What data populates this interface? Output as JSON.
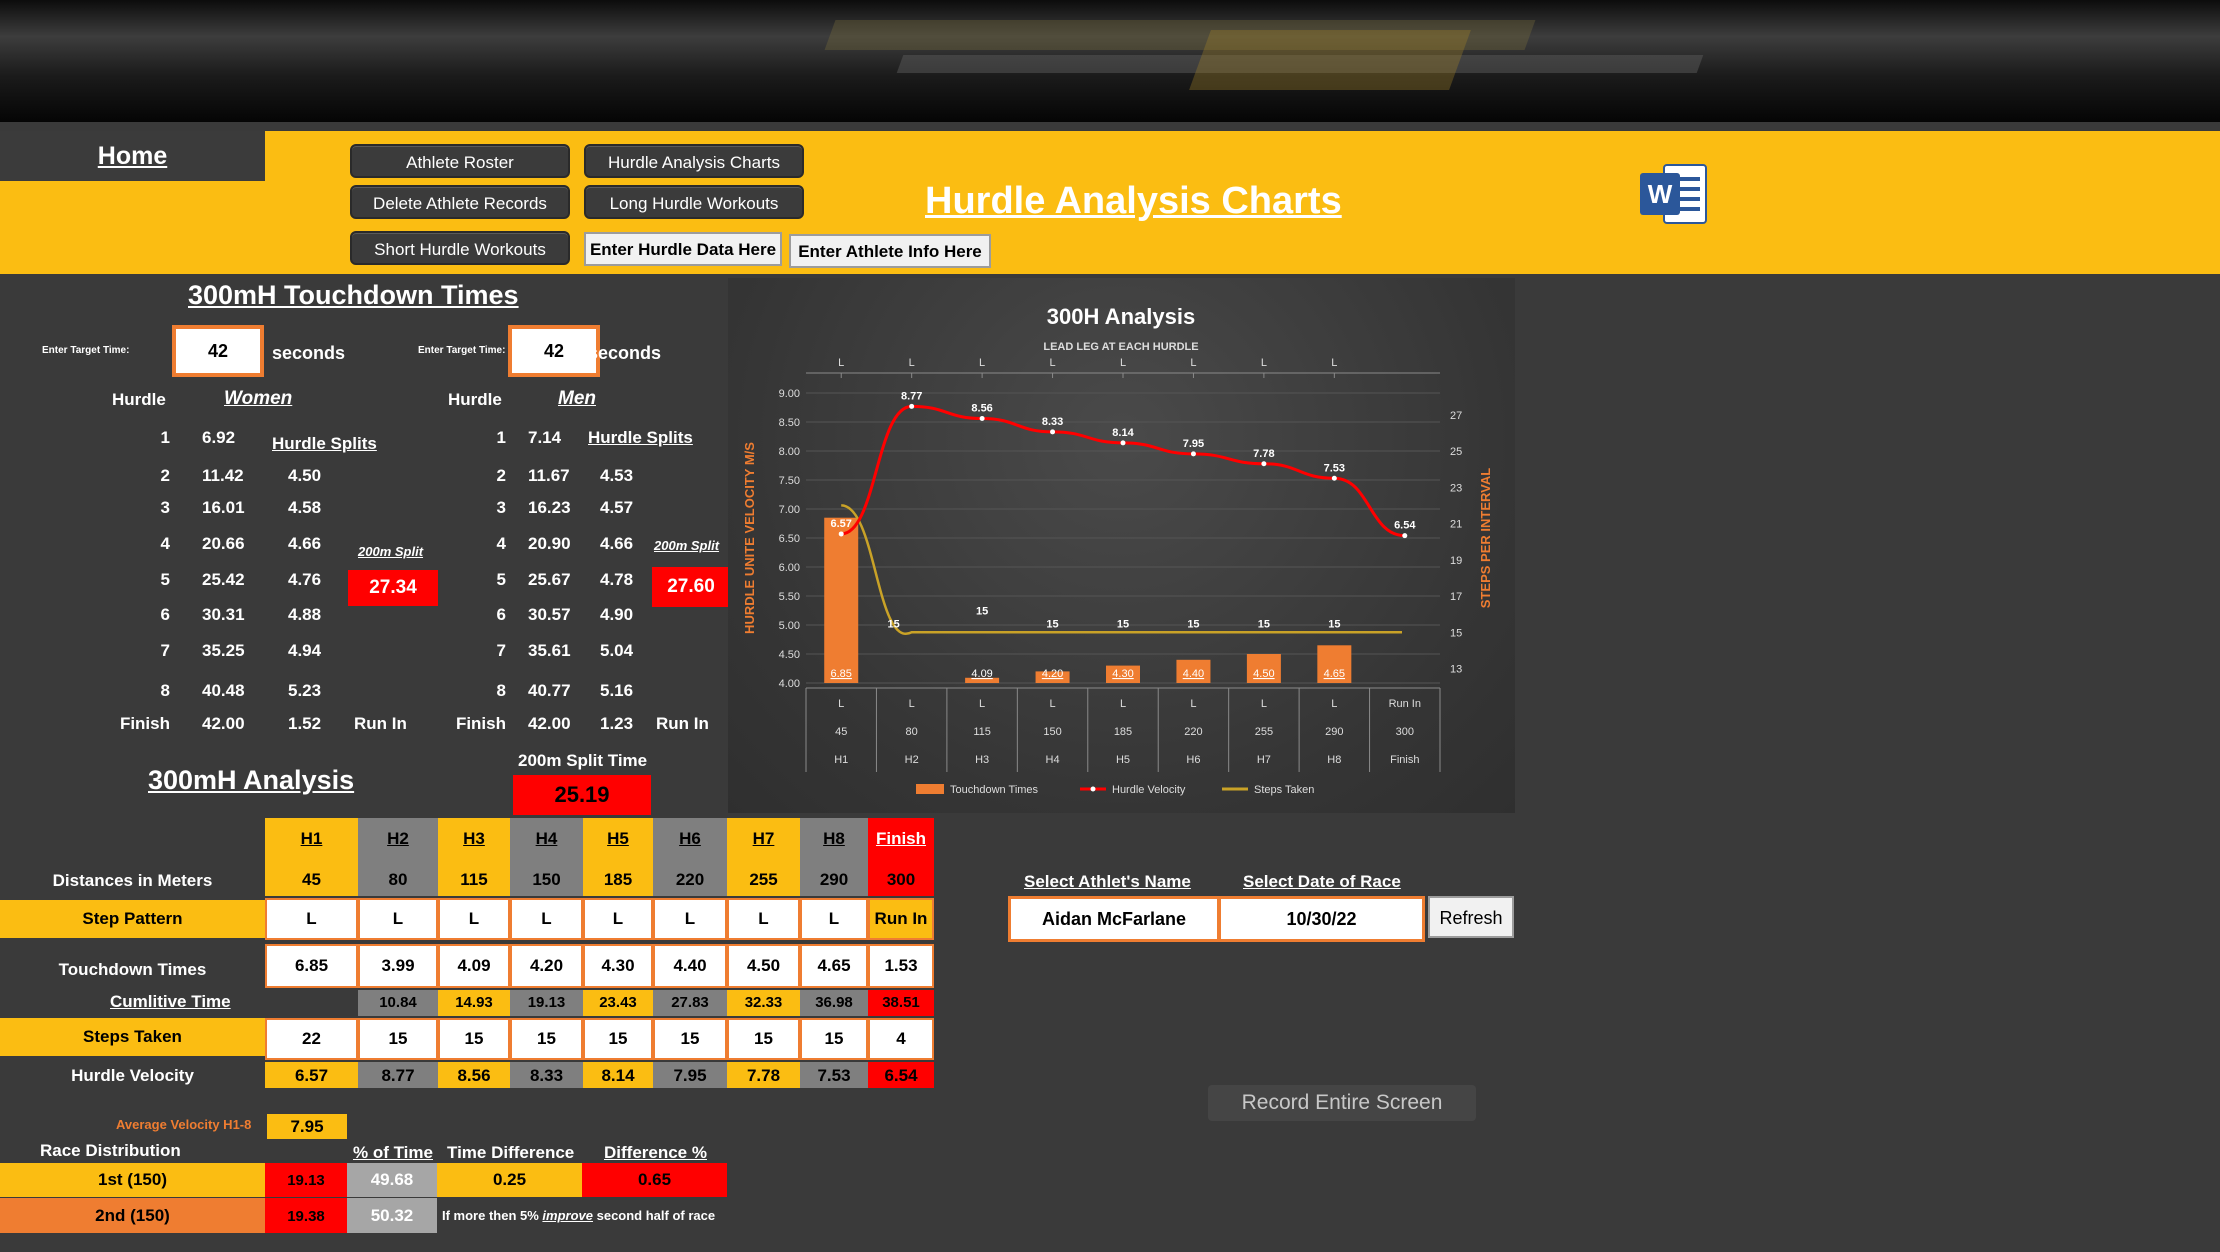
{
  "nav": {
    "home": "Home",
    "buttons": [
      "Athlete Roster",
      "Hurdle Analysis Charts",
      "Delete Athlete Records",
      "Long Hurdle Workouts",
      "Short Hurdle Workouts"
    ],
    "enter_hurdle": "Enter Hurdle Data Here",
    "enter_athlete": "Enter Athlete Info Here"
  },
  "page_title": "Hurdle Analysis Charts",
  "touchdown": {
    "title": "300mH Touchdown Times",
    "enter_target_label": "Enter Target Time:",
    "seconds": "seconds",
    "hurdle_label": "Hurdle",
    "splits_label": "Hurdle Splits",
    "split200_label": "200m Split",
    "run_in": "Run In",
    "women": {
      "label": "Women",
      "target": "42",
      "rows": [
        {
          "h": "1",
          "t": "6.92",
          "s": ""
        },
        {
          "h": "2",
          "t": "11.42",
          "s": "4.50"
        },
        {
          "h": "3",
          "t": "16.01",
          "s": "4.58"
        },
        {
          "h": "4",
          "t": "20.66",
          "s": "4.66"
        },
        {
          "h": "5",
          "t": "25.42",
          "s": "4.76"
        },
        {
          "h": "6",
          "t": "30.31",
          "s": "4.88"
        },
        {
          "h": "7",
          "t": "35.25",
          "s": "4.94"
        },
        {
          "h": "8",
          "t": "40.48",
          "s": "5.23"
        },
        {
          "h": "Finish",
          "t": "42.00",
          "s": "1.52"
        }
      ],
      "split200": "27.34"
    },
    "men": {
      "label": "Men",
      "target": "42",
      "rows": [
        {
          "h": "1",
          "t": "7.14",
          "s": ""
        },
        {
          "h": "2",
          "t": "11.67",
          "s": "4.53"
        },
        {
          "h": "3",
          "t": "16.23",
          "s": "4.57"
        },
        {
          "h": "4",
          "t": "20.90",
          "s": "4.66"
        },
        {
          "h": "5",
          "t": "25.67",
          "s": "4.78"
        },
        {
          "h": "6",
          "t": "30.57",
          "s": "4.90"
        },
        {
          "h": "7",
          "t": "35.61",
          "s": "5.04"
        },
        {
          "h": "8",
          "t": "40.77",
          "s": "5.16"
        },
        {
          "h": "Finish",
          "t": "42.00",
          "s": "1.23"
        }
      ],
      "split200": "27.60"
    }
  },
  "analysis": {
    "title": "300mH Analysis",
    "split_time_label": "200m Split Time",
    "split_time": "25.19",
    "headers": [
      "H1",
      "H2",
      "H3",
      "H4",
      "H5",
      "H6",
      "H7",
      "H8",
      "Finish"
    ],
    "labels": {
      "distances": "Distances in Meters",
      "step_pattern": "Step Pattern",
      "touchdown": "Touchdown Times",
      "cumulative": "Cumlitive Time",
      "steps": "Steps Taken",
      "velocity": "Hurdle Velocity",
      "avg_velocity": "Average Velocity H1-8"
    },
    "distances": [
      "45",
      "80",
      "115",
      "150",
      "185",
      "220",
      "255",
      "290",
      "300"
    ],
    "step_pattern": [
      "L",
      "L",
      "L",
      "L",
      "L",
      "L",
      "L",
      "L",
      "Run In"
    ],
    "touchdown": [
      "6.85",
      "3.99",
      "4.09",
      "4.20",
      "4.30",
      "4.40",
      "4.50",
      "4.65",
      "1.53"
    ],
    "cumulative": [
      "",
      "10.84",
      "14.93",
      "19.13",
      "23.43",
      "27.83",
      "32.33",
      "36.98",
      "38.51"
    ],
    "steps": [
      "22",
      "15",
      "15",
      "15",
      "15",
      "15",
      "15",
      "15",
      "4"
    ],
    "velocity": [
      "6.57",
      "8.77",
      "8.56",
      "8.33",
      "8.14",
      "7.95",
      "7.78",
      "7.53",
      "6.54"
    ],
    "avg_velocity": "7.95"
  },
  "distribution": {
    "title": "Race  Distribution",
    "headers": [
      "% of Time",
      "Time Difference",
      "Difference %"
    ],
    "first_label": "1st  (150)",
    "second_label": "2nd (150)",
    "first_time": "19.13",
    "second_time": "19.38",
    "first_pct": "49.68",
    "second_pct": "50.32",
    "time_diff": "0.25",
    "diff_pct": "0.65",
    "note_prefix": "If more then 5% ",
    "note_em": "improve",
    "note_suffix": " second half of race"
  },
  "select": {
    "athlete_label": "Select Athlet's Name",
    "date_label": "Select Date of Race",
    "athlete": "Aidan McFarlane",
    "date": "10/30/22",
    "refresh": "Refresh"
  },
  "record": "Record Entire Screen",
  "word_icon": "word-icon",
  "colors": {
    "accent": "#fbbd12",
    "orange": "#ef7d31",
    "red": "#ff0000",
    "bg": "#3a3a3a"
  },
  "chart_data": {
    "type": "bar",
    "title": "300H Analysis",
    "subtitle": "LEAD LEG  AT EACH HURDLE",
    "top_labels": [
      "L",
      "L",
      "L",
      "L",
      "L",
      "L",
      "L",
      "L"
    ],
    "categories": [
      {
        "leg": "L",
        "dist": "45",
        "name": "H1"
      },
      {
        "leg": "L",
        "dist": "80",
        "name": "H2"
      },
      {
        "leg": "L",
        "dist": "115",
        "name": "H3"
      },
      {
        "leg": "L",
        "dist": "150",
        "name": "H4"
      },
      {
        "leg": "L",
        "dist": "185",
        "name": "H5"
      },
      {
        "leg": "L",
        "dist": "220",
        "name": "H6"
      },
      {
        "leg": "L",
        "dist": "255",
        "name": "H7"
      },
      {
        "leg": "L",
        "dist": "290",
        "name": "H8"
      },
      {
        "leg": "Run In",
        "dist": "300",
        "name": "Finish"
      }
    ],
    "ylabel_left": "HURDLE  UNITE  VELOCITY  M/S",
    "ylabel_right": "STEPS PER INTERVAL",
    "y_left_ticks": [
      "4.00",
      "4.50",
      "5.00",
      "5.50",
      "6.00",
      "6.50",
      "7.00",
      "7.50",
      "8.00",
      "8.50",
      "9.00"
    ],
    "y_left_range": [
      4,
      9
    ],
    "y_right_ticks": [
      "13",
      "15",
      "17",
      "19",
      "21",
      "23",
      "25",
      "27"
    ],
    "y_right_range": [
      12.2,
      28.2
    ],
    "series": [
      {
        "name": "Touchdown Times",
        "kind": "bar",
        "axis": "left",
        "color": "#ef7d31",
        "values": [
          6.85,
          null,
          4.09,
          4.2,
          4.3,
          4.4,
          4.5,
          4.65,
          null
        ],
        "labels": [
          "6.85",
          "",
          "4.09",
          "4.20",
          "4.30",
          "4.40",
          "4.50",
          "4.65",
          ""
        ]
      },
      {
        "name": "Hurdle Velocity",
        "kind": "line",
        "axis": "left",
        "color": "#ff0000",
        "values": [
          6.57,
          8.77,
          8.56,
          8.33,
          8.14,
          7.95,
          7.78,
          7.53,
          6.54
        ],
        "labels": [
          "6.57",
          "8.77",
          "8.56",
          "8.33",
          "8.14",
          "7.95",
          "7.78",
          "7.53",
          "6.54"
        ]
      },
      {
        "name": "Steps Taken",
        "kind": "curve",
        "axis": "right",
        "color": "#c9a227",
        "values": [
          22,
          15,
          15,
          15,
          15,
          15,
          15,
          15,
          null
        ],
        "labels": [
          "",
          "15",
          "15",
          "15",
          "15",
          "15",
          "15",
          "15",
          ""
        ]
      }
    ],
    "grid": true,
    "legend": "bottom"
  }
}
